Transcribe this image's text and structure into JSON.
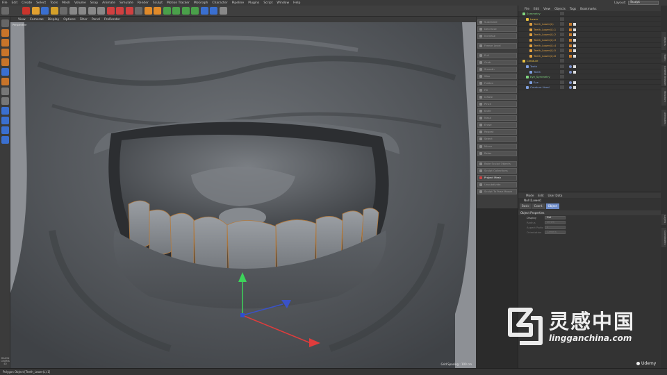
{
  "menubar": {
    "items": [
      "File",
      "Edit",
      "Create",
      "Select",
      "Tools",
      "Mesh",
      "Volume",
      "Snap",
      "Animate",
      "Simulate",
      "Render",
      "Sculpt",
      "Motion Tracker",
      "MoGraph",
      "Character",
      "Pipeline",
      "Plugins",
      "Script",
      "Window",
      "Help"
    ],
    "layout_label": "Layout:",
    "layout_value": "Sculpt"
  },
  "viewport": {
    "menu": [
      "View",
      "Cameras",
      "Display",
      "Options",
      "Filter",
      "Panel",
      "ProRender"
    ],
    "camera_label": "Perspective",
    "grid_spacing": "Grid Spacing : 100 cm"
  },
  "palette": {
    "items": [
      {
        "label": "Subdivide",
        "active": false
      },
      {
        "label": "Decrease",
        "active": false
      },
      {
        "label": "Increase",
        "active": false
      },
      {
        "label": "Freeze Level",
        "active": false
      },
      {
        "label": "Pull",
        "active": false
      },
      {
        "label": "Grab",
        "active": false
      },
      {
        "label": "Smooth",
        "active": false
      },
      {
        "label": "Wax",
        "active": false
      },
      {
        "label": "Flatten",
        "active": false
      },
      {
        "label": "Fill",
        "active": false
      },
      {
        "label": "Inflate",
        "active": false
      },
      {
        "label": "Pinch",
        "active": false
      },
      {
        "label": "Knife",
        "active": false
      },
      {
        "label": "Mask",
        "active": false
      },
      {
        "label": "Erase",
        "active": false
      },
      {
        "label": "Repeat",
        "active": false
      },
      {
        "label": "Select",
        "active": false
      },
      {
        "label": "Mirror",
        "active": false
      },
      {
        "label": "Relax",
        "active": false
      },
      {
        "label": "Bake Sculpt Objects",
        "active": false
      },
      {
        "label": "Sculpt Collections",
        "active": false
      },
      {
        "label": "Project Mesh",
        "active": true
      },
      {
        "label": "Unsubdivide",
        "active": false
      },
      {
        "label": "Sculpt To Pose Morph",
        "active": false
      }
    ]
  },
  "object_manager": {
    "menu": [
      "File",
      "Edit",
      "View",
      "Objects",
      "Tags",
      "Bookmarks"
    ],
    "rows": [
      {
        "label": "Symmetry",
        "indent": 0,
        "color": "#7fd67f"
      },
      {
        "label": "Lower",
        "indent": 1,
        "color": "#e8c040"
      },
      {
        "label": "Teeth_Lower(L)",
        "indent": 2,
        "color": "#e0a040"
      },
      {
        "label": "Teeth_Lower(L).1",
        "indent": 2,
        "color": "#e0a040"
      },
      {
        "label": "Teeth_Lower(L).2",
        "indent": 2,
        "color": "#e0a040"
      },
      {
        "label": "Teeth_Lower(L).3",
        "indent": 2,
        "color": "#e0a040"
      },
      {
        "label": "Teeth_Lower(L).4",
        "indent": 2,
        "color": "#e0a040"
      },
      {
        "label": "Teeth_Lower(L).5",
        "indent": 2,
        "color": "#e0a040"
      },
      {
        "label": "Teeth_Lower(L).6",
        "indent": 2,
        "color": "#e0a040"
      },
      {
        "label": "Creature",
        "indent": 0,
        "color": "#e8c040"
      },
      {
        "label": "Teeth",
        "indent": 1,
        "color": "#7fa0e0"
      },
      {
        "label": "Teeth",
        "indent": 2,
        "color": "#7fa0e0"
      },
      {
        "label": "Eye_Symmetry",
        "indent": 1,
        "color": "#7fd67f"
      },
      {
        "label": "Eye",
        "indent": 2,
        "color": "#7fa0e0"
      },
      {
        "label": "Creature Head",
        "indent": 1,
        "color": "#7fa0e0"
      }
    ]
  },
  "attribute_manager": {
    "menu": [
      "Mode",
      "Edit",
      "User Data"
    ],
    "title": "Null [Lower]",
    "tabs": [
      {
        "label": "Basic",
        "selected": false
      },
      {
        "label": "Coord.",
        "selected": false
      },
      {
        "label": "Object",
        "selected": true
      }
    ],
    "section": "Object Properties",
    "fields": [
      {
        "label": "Display",
        "value": "Dot",
        "dim": false
      },
      {
        "label": "Radius",
        "value": "10 cm",
        "dim": true
      },
      {
        "label": "Aspect Ratio",
        "value": "1",
        "dim": true
      },
      {
        "label": "Orientation",
        "value": "Camera",
        "dim": true
      }
    ]
  },
  "side_tabs": [
    "Objects",
    "Takes",
    "Content Browser",
    "Structure",
    "Attributes",
    "Layers",
    "Coordinates"
  ],
  "left_tools": {
    "logo": "MAXON CINEMA 4D"
  },
  "status_bar": "Polygon Object [Teeth_Lower(L).1]",
  "watermark": {
    "main": "灵感中国",
    "url": "lingganchina.com"
  },
  "udemy": "Udemy",
  "colors": {
    "accent": "#6e8cc8",
    "axis_y": "#3dd35a",
    "axis_x": "#e03c3c",
    "axis_z": "#3a52c8"
  }
}
